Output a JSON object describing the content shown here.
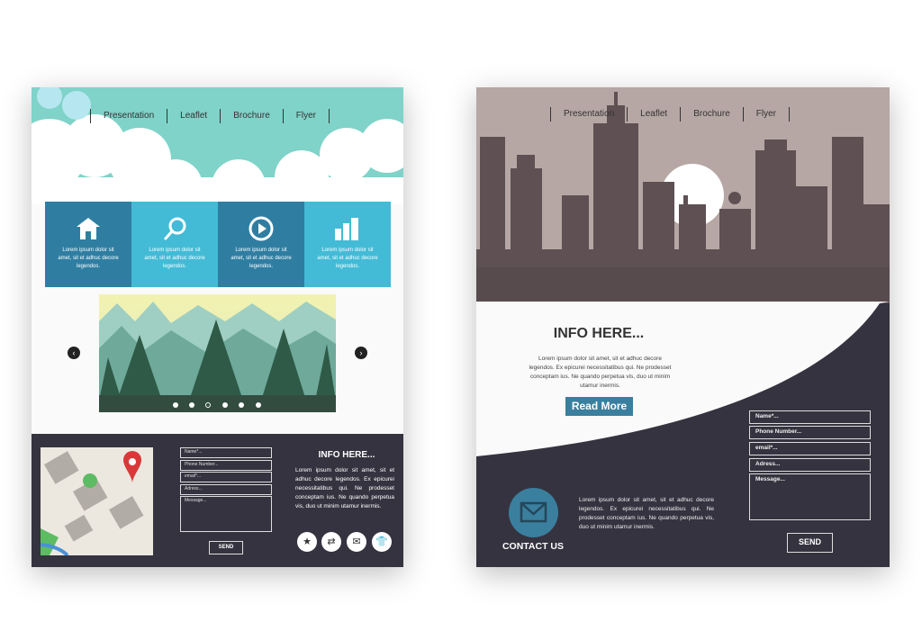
{
  "left_template": {
    "nav": [
      "Presentation",
      "Leaflet",
      "Brochure",
      "Flyer"
    ],
    "features": [
      {
        "icon": "home-icon",
        "text": "Lorem ipsum dolor sit amet, sit et adhuc decore legendos.",
        "color": "#2f7ea2"
      },
      {
        "icon": "search-icon",
        "text": "Lorem ipsum dolor sit amet, sit et adhuc decore legendos.",
        "color": "#43bbd6"
      },
      {
        "icon": "play-icon",
        "text": "Lorem ipsum dolor sit amet, sit et adhuc decore legendos.",
        "color": "#2f7ea2"
      },
      {
        "icon": "bar-chart-icon",
        "text": "Lorem ipsum dolor sit amet, sit et adhuc decore legendos.",
        "color": "#43bbd6"
      }
    ],
    "slider": {
      "dots": 6,
      "active_dot": 3
    },
    "form": {
      "fields": [
        "Name*...",
        "Phone Number...",
        "email*...",
        "Adress...",
        "Message..."
      ],
      "send": "SEND"
    },
    "info": {
      "title": "INFO HERE...",
      "text": "Lorem ipsum dolor sit amet, sit et adhuc decore legendos. Ex epicurei necessitatibus qui. Ne prodesset conceptam ius. Ne quando perpetua vis, duo ut minim utamur inermis."
    },
    "social_icons": [
      "star-icon",
      "share-icon",
      "mail-icon",
      "shirt-icon"
    ]
  },
  "right_template": {
    "nav": [
      "Presentation",
      "Leaflet",
      "Brochure",
      "Flyer"
    ],
    "info": {
      "title": "INFO HERE...",
      "text": "Lorem ipsum dolor sit amet, sit et adhuc decore legendos. Ex epicurei necessitatibus qui. Ne prodesset conceptam ius. Ne quando perpetua vis, duo ut minim utamur inermis.",
      "button": "Read More"
    },
    "contact": {
      "title": "CONTACT US",
      "text": "Lorem ipsum dolor sit amet, sit et adhuc decore legendos. Ex epicurei necessitatibus qui. Ne prodesset conceptam ius. Ne quando perpetua vis, duo ut minim utamur inermis."
    },
    "form": {
      "fields": [
        "Name*...",
        "Phone Number...",
        "email*...",
        "Adress...",
        "Message..."
      ],
      "send": "SEND"
    }
  },
  "colors": {
    "dark": "#35333f",
    "accent": "#2f7ea2",
    "light_accent": "#43bbd6",
    "city_bg": "#b6a7a4",
    "city": "#5e5053"
  }
}
